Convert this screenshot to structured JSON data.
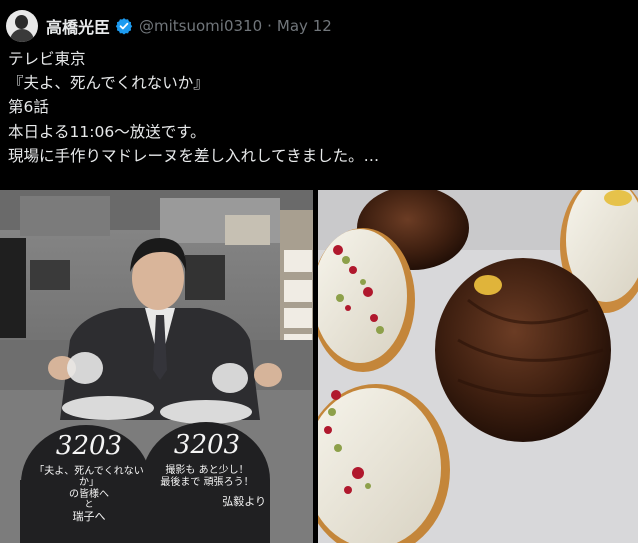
{
  "tweet": {
    "author_name": "高橋光臣",
    "handle": "@mitsuomi0310",
    "separator": "·",
    "date": "May 12",
    "text": "テレビ東京\n『夫よ、死んでくれないか』\n第6話\n本日よる11:06〜放送です。\n現場に手作りマドレーヌを差し入れしてきました。…",
    "verified_icon": "verified-badge-icon",
    "verified_color": "#1d9bf0"
  },
  "media": {
    "left_image": {
      "box_left_lines": [
        "3203",
        "「夫よ、死んでくれないか」",
        "の皆様へ",
        "と",
        "瑞子へ"
      ],
      "box_right_lines": [
        "3203",
        "撮影も あと少し！",
        "最後まで 頑張ろう！",
        "弘毅より"
      ]
    }
  }
}
